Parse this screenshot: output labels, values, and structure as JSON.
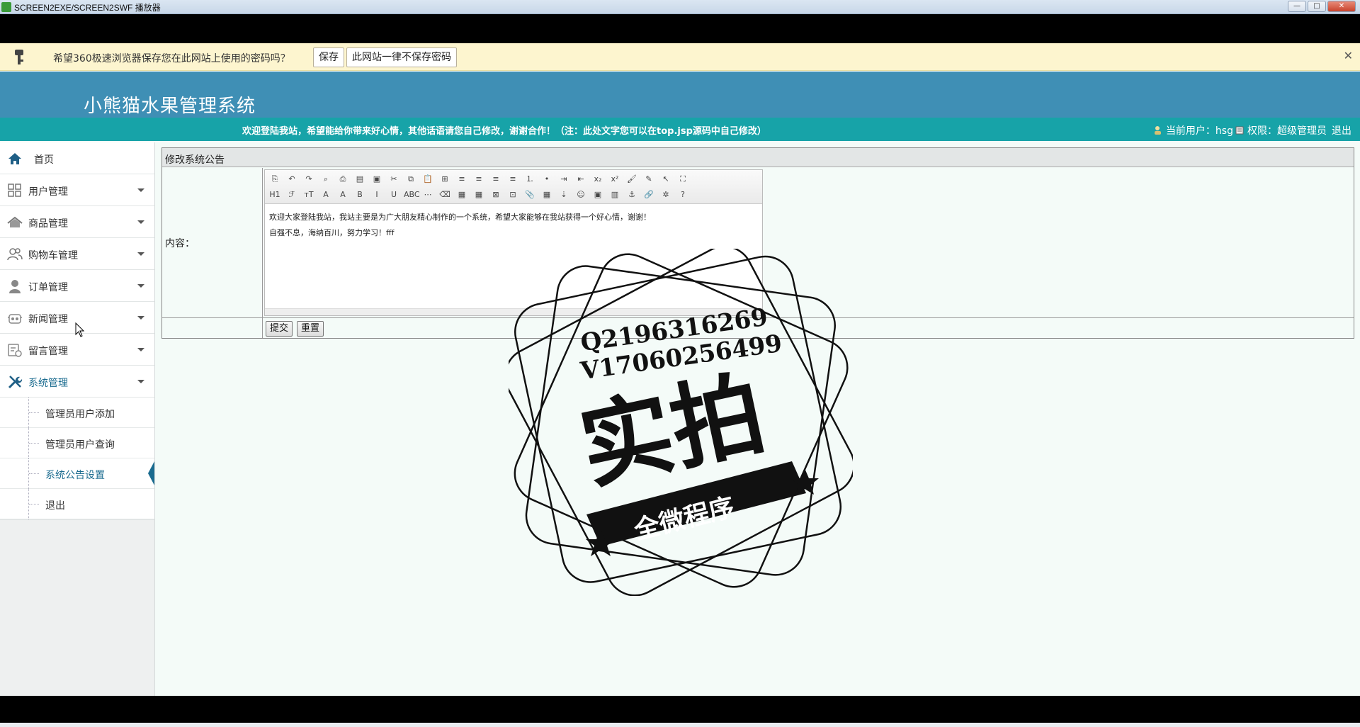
{
  "window": {
    "title": "SCREEN2EXE/SCREEN2SWF 播放器",
    "min_label": "—",
    "max_label": "□",
    "close_label": "✕"
  },
  "password_bar": {
    "message": "希望360极速浏览器保存您在此网站上使用的密码吗？",
    "save_label": "保存",
    "never_label": "此网站一律不保存密码",
    "close_label": "✕"
  },
  "header": {
    "site_title": "小熊猫水果管理系统",
    "welcome": "欢迎登陆我站，希望能给你带来好心情，其他话语请您自己修改，谢谢合作！（注：此处文字您可以在top.jsp源码中自己修改）",
    "current_user_label": "当前用户：hsg",
    "permission_label": "权限：超级管理员",
    "logout_label": "退出"
  },
  "sidebar": {
    "items": [
      {
        "label": "首页",
        "icon": "home-icon"
      },
      {
        "label": "用户管理",
        "icon": "grid-icon"
      },
      {
        "label": "商品管理",
        "icon": "house-icon"
      },
      {
        "label": "购物车管理",
        "icon": "users-icon"
      },
      {
        "label": "订单管理",
        "icon": "user-icon"
      },
      {
        "label": "新闻管理",
        "icon": "news-icon"
      },
      {
        "label": "留言管理",
        "icon": "message-icon"
      },
      {
        "label": "系统管理",
        "icon": "tools-icon"
      }
    ],
    "sub_items": [
      {
        "label": "管理员用户添加"
      },
      {
        "label": "管理员用户查询"
      },
      {
        "label": "系统公告设置"
      },
      {
        "label": "退出"
      }
    ]
  },
  "panel": {
    "title": "修改系统公告",
    "content_label": "内容：",
    "editor_lines": [
      "欢迎大家登陆我站，我站主要是为广大朋友精心制作的一个系统，希望大家能够在我站获得一个好心情，谢谢！",
      "自强不息，海纳百川，努力学习！fff"
    ],
    "submit_label": "提交",
    "reset_label": "重置"
  },
  "toolbar": {
    "row1": [
      "⎘",
      "↶",
      "↷",
      "⌕",
      "⎙",
      "▤",
      "▣",
      "✂",
      "⧉",
      "📋",
      "⊞",
      "≡",
      "≡",
      "≡",
      "≡",
      "⒈",
      "•",
      "⇥",
      "⇤",
      "x₂",
      "x²",
      "🖌",
      "✎",
      "↖",
      "⛶"
    ],
    "row2": [
      "H1",
      "ℱ",
      "тT",
      "A",
      "A",
      "B",
      "I",
      "U",
      "ABC",
      "⋯",
      "⌫",
      "▦",
      "▦",
      "⊠",
      "⊡",
      "📎",
      "▦",
      "⇣",
      "☺",
      "▣",
      "▥",
      "⚓",
      "🔗",
      "✲",
      "?"
    ]
  },
  "watermark": {
    "line1": "Q2196316269",
    "line2": "V17060256499",
    "big": "实拍",
    "ribbon": "全微程序"
  }
}
